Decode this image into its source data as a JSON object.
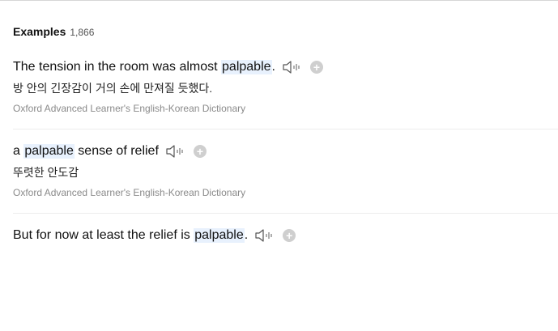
{
  "header": {
    "title": "Examples",
    "count": "1,866"
  },
  "examples": [
    {
      "before": "The tension in the room was almost ",
      "highlight": "palpable",
      "after": ".",
      "translation": "방 안의 긴장감이 거의 손에 만져질 듯했다.",
      "source": "Oxford Advanced Learner's English-Korean Dictionary"
    },
    {
      "before": "a ",
      "highlight": "palpable",
      "after": " sense of relief",
      "translation": "뚜렷한 안도감",
      "source": "Oxford Advanced Learner's English-Korean Dictionary"
    },
    {
      "before": "But for now at least the relief is ",
      "highlight": "palpable",
      "after": "."
    }
  ],
  "icons": {
    "speaker": "speaker-icon",
    "add": "plus-circle-icon"
  },
  "colors": {
    "highlight": "#e8f1fd",
    "source_text": "#8a8a8a",
    "add_button": "#cfcfcf"
  }
}
